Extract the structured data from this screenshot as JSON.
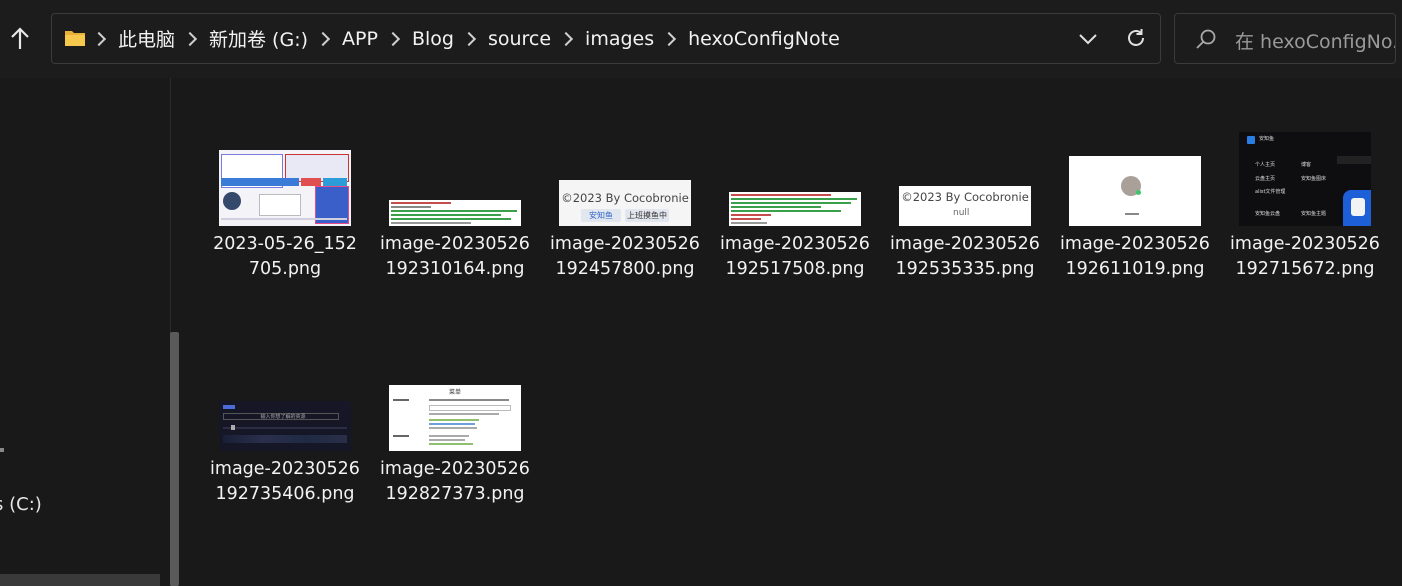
{
  "address_bar": {
    "crumbs": [
      "此电脑",
      "新加卷 (G:)",
      "APP",
      "Blog",
      "source",
      "images",
      "hexoConfigNote"
    ]
  },
  "search": {
    "placeholder": "在 hexoConfigNo..."
  },
  "nav_pane": {
    "items": [
      {
        "label": "s (C:)"
      },
      {
        "label": ")"
      }
    ]
  },
  "files": [
    {
      "name": "2023-05-26_152705.png",
      "thumb_text": []
    },
    {
      "name": "image-20230526192310164.png",
      "thumb_text": []
    },
    {
      "name": "image-20230526192457800.png",
      "thumb_text": [
        "©2023 By Cocobronie",
        "安知鱼",
        "上班摸鱼中"
      ]
    },
    {
      "name": "image-20230526192517508.png",
      "thumb_text": []
    },
    {
      "name": "image-20230526192535335.png",
      "thumb_text": [
        "©2023 By Cocobronie",
        "null"
      ]
    },
    {
      "name": "image-20230526192611019.png",
      "thumb_text": []
    },
    {
      "name": "image-20230526192715672.png",
      "thumb_text": [
        "安知鱼",
        "个人主页",
        "博客",
        "云盘主页",
        "安知鱼图床",
        "alist文件管理",
        "安知鱼云盘",
        "安知鱼主题"
      ]
    },
    {
      "name": "image-20230526192735406.png",
      "thumb_text": [
        "输入你想了解的资源"
      ]
    },
    {
      "name": "image-20230526192827373.png",
      "thumb_text": [
        "菜单"
      ]
    }
  ]
}
